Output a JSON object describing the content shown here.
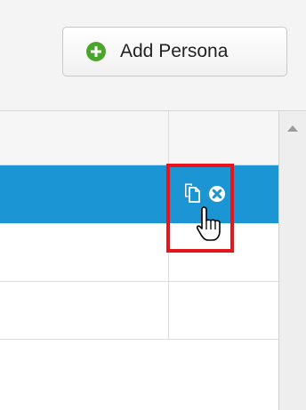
{
  "toolbar": {
    "add_persona_label": "Add Persona",
    "add_icon": "plus-circle-icon"
  },
  "table": {
    "selected_row_actions": [
      {
        "name": "copy-icon"
      },
      {
        "name": "remove-icon"
      }
    ]
  },
  "colors": {
    "selected_row": "#1b95d3",
    "add_icon": "#4aa62b",
    "highlight": "#e8141b"
  }
}
